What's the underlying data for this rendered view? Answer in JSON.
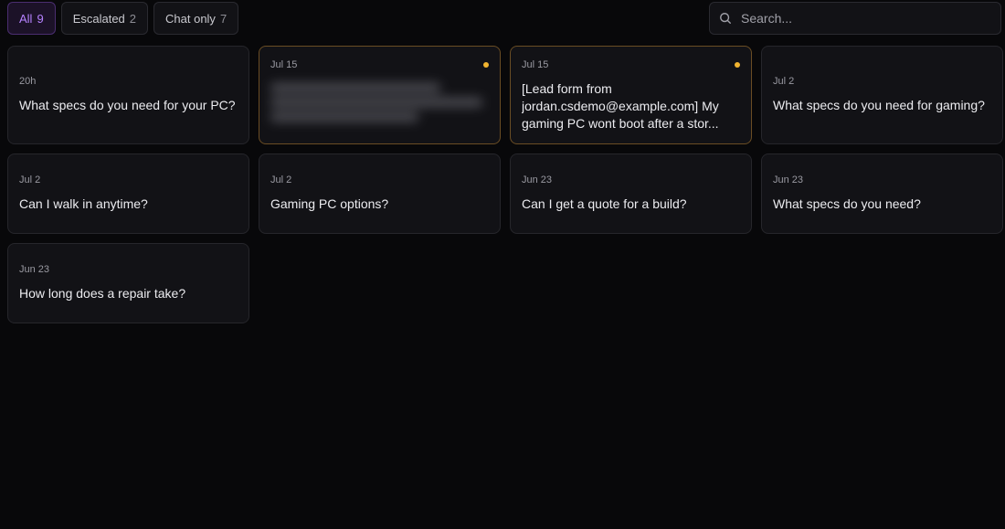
{
  "filters": {
    "tabs": [
      {
        "label": "All",
        "count": "9"
      },
      {
        "label": "Escalated",
        "count": "2"
      },
      {
        "label": "Chat only",
        "count": "7"
      }
    ],
    "active_index": 0
  },
  "search": {
    "placeholder": "Search..."
  },
  "conversations": [
    {
      "date": "20h",
      "text": "What specs do you need for your PC?",
      "unread": false
    },
    {
      "date": "Jul 15",
      "text": "",
      "unread": true,
      "redacted": true
    },
    {
      "date": "Jul 15",
      "text": "[Lead form from jordan.csdemo@example.com] My gaming PC wont boot after a stor...",
      "unread": true
    },
    {
      "date": "Jul 2",
      "text": "What specs do you need for gaming?",
      "unread": false
    },
    {
      "date": "Jul 2",
      "text": "Can I walk in anytime?",
      "unread": false
    },
    {
      "date": "Jul 2",
      "text": "Gaming PC options?",
      "unread": false
    },
    {
      "date": "Jun 23",
      "text": "Can I get a quote for a build?",
      "unread": false
    },
    {
      "date": "Jun 23",
      "text": "What specs do you need?",
      "unread": false
    },
    {
      "date": "Jun 23",
      "text": "How long does a repair take?",
      "unread": false
    }
  ],
  "colors": {
    "accent": "#b682ff",
    "unread_dot": "#f1b430",
    "background": "#08080a"
  }
}
